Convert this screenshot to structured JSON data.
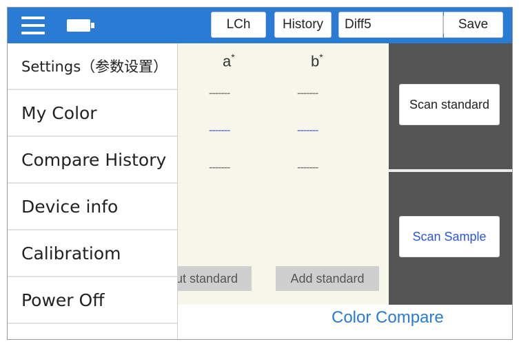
{
  "topbar": {
    "menu_icon": "hamburger-menu-icon",
    "battery_icon": "battery-icon",
    "lch_label": "LCh",
    "history_label": "History",
    "diff_value": "Diff5",
    "save_label": "Save",
    "background_color": "#2a7bd4"
  },
  "table": {
    "columns": [
      {
        "label": "a",
        "sup": "*"
      },
      {
        "label": "b",
        "sup": "*"
      }
    ],
    "rows": [
      [
        "-------",
        "-------"
      ],
      [
        "-------",
        "-------"
      ],
      [
        "-------",
        "-------"
      ]
    ]
  },
  "buttons": {
    "put_standard_visible": "ut standard",
    "add_standard": "Add standard",
    "scan_standard": "Scan standard",
    "scan_sample": "Scan Sample"
  },
  "footer": {
    "title": "Color Compare"
  },
  "drawer": {
    "items": [
      "Settings（参数设置）",
      "My Color",
      "Compare History",
      "Device info",
      "Calibratiom",
      "Power Off"
    ]
  }
}
